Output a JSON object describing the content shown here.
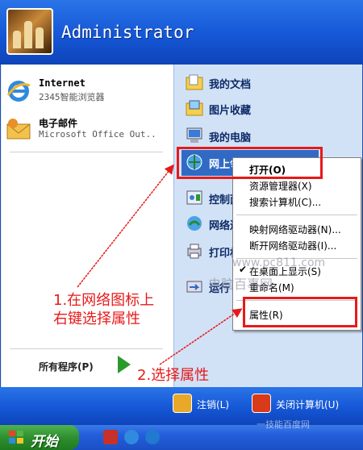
{
  "user": {
    "name": "Administrator"
  },
  "pinned": [
    {
      "title": "Internet",
      "subtitle": "2345智能浏览器",
      "icon": "ie-icon"
    },
    {
      "title": "电子邮件",
      "subtitle": "Microsoft Office Out..",
      "icon": "outlook-icon"
    }
  ],
  "all_programs": "所有程序(P)",
  "right_items": [
    {
      "label": "我的文档",
      "icon": "folder-documents-icon"
    },
    {
      "label": "图片收藏",
      "icon": "folder-pictures-icon"
    },
    {
      "label": "我的电脑",
      "icon": "my-computer-icon"
    },
    {
      "label": "网上邻居",
      "icon": "network-icon"
    },
    {
      "label": "控制面板",
      "icon": "control-panel-icon"
    },
    {
      "label": "网络连接",
      "icon": "network-connections-icon"
    },
    {
      "label": "打印机和传真",
      "icon": "printer-icon"
    },
    {
      "label": "运行",
      "icon": "run-icon"
    }
  ],
  "context_menu": {
    "items": [
      "打开(O)",
      "资源管理器(X)",
      "搜索计算机(C)...",
      "映射网络驱动器(N)...",
      "断开网络驱动器(I)...",
      "在桌面上显示(S)",
      "重命名(M)",
      "属性(R)"
    ],
    "checked": "在桌面上显示(S)"
  },
  "footer": {
    "logoff": "注销(L)",
    "shutdown": "关闭计算机(U)"
  },
  "taskbar": {
    "start": "开始"
  },
  "annotations": {
    "step1_line1": "1.在网络图标上",
    "step1_line2": "右键选择属性",
    "step2": "2.选择属性"
  },
  "watermark": {
    "site": "www.pc811.com",
    "brand": "电脑百事网",
    "corner": "一技能百度网"
  },
  "colors": {
    "annotation": "#e61a1a",
    "selection": "#316ac5",
    "xp_blue": "#1557d6"
  }
}
